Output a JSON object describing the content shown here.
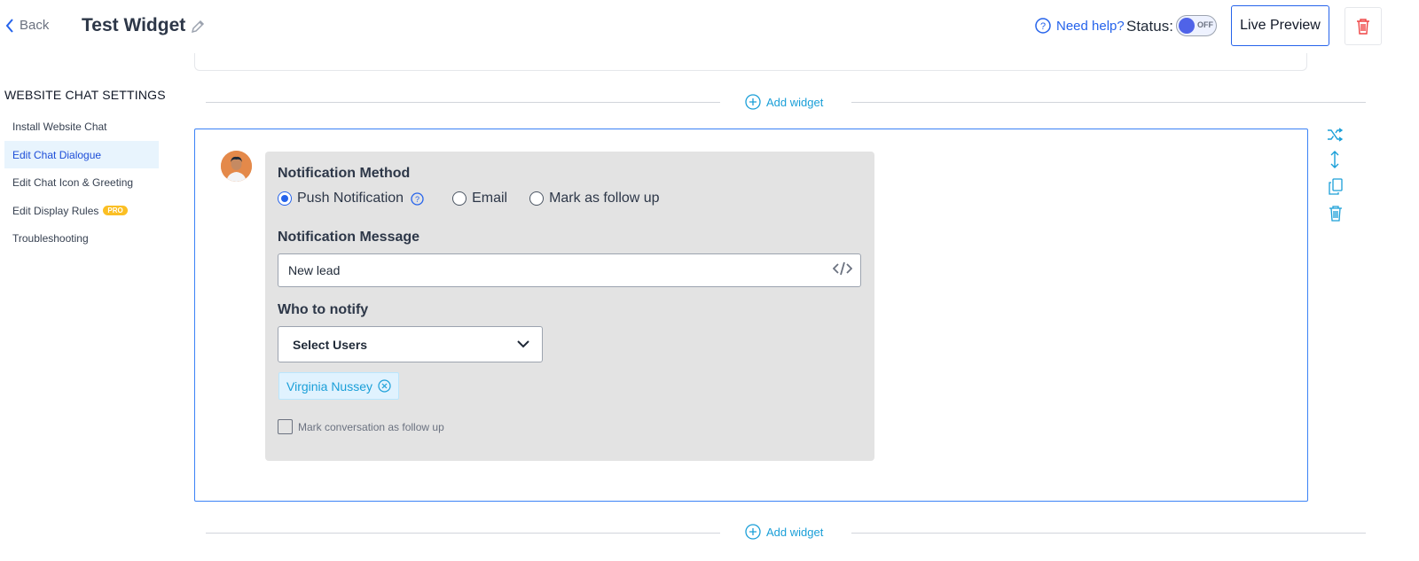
{
  "header": {
    "back_label": "Back",
    "title": "Test Widget",
    "help_label": "Need help?",
    "status_label": "Status:",
    "toggle_state": "OFF",
    "live_preview_label": "Live Preview"
  },
  "sidebar": {
    "heading": "WEBSITE CHAT SETTINGS",
    "items": [
      {
        "label": "Install Website Chat"
      },
      {
        "label": "Edit Chat Dialogue"
      },
      {
        "label": "Edit Chat Icon & Greeting"
      },
      {
        "label": "Edit Display Rules"
      },
      {
        "label": "Troubleshooting"
      }
    ],
    "pro_badge": "PRO"
  },
  "add_widget_label": "Add widget",
  "widget": {
    "notification_method_label": "Notification Method",
    "options": [
      "Push Notification",
      "Email",
      "Mark as follow up"
    ],
    "selected_option": "Push Notification",
    "notification_message_label": "Notification Message",
    "notification_message_value": "New lead",
    "who_to_notify_label": "Who to notify",
    "select_users_label": "Select Users",
    "selected_user": "Virginia Nussey",
    "follow_up_checkbox_label": "Mark conversation as follow up"
  },
  "colors": {
    "accent": "#2563eb",
    "link": "#1a9fd8",
    "delete": "#ef4444",
    "panel_bg": "#e3e3e3"
  }
}
